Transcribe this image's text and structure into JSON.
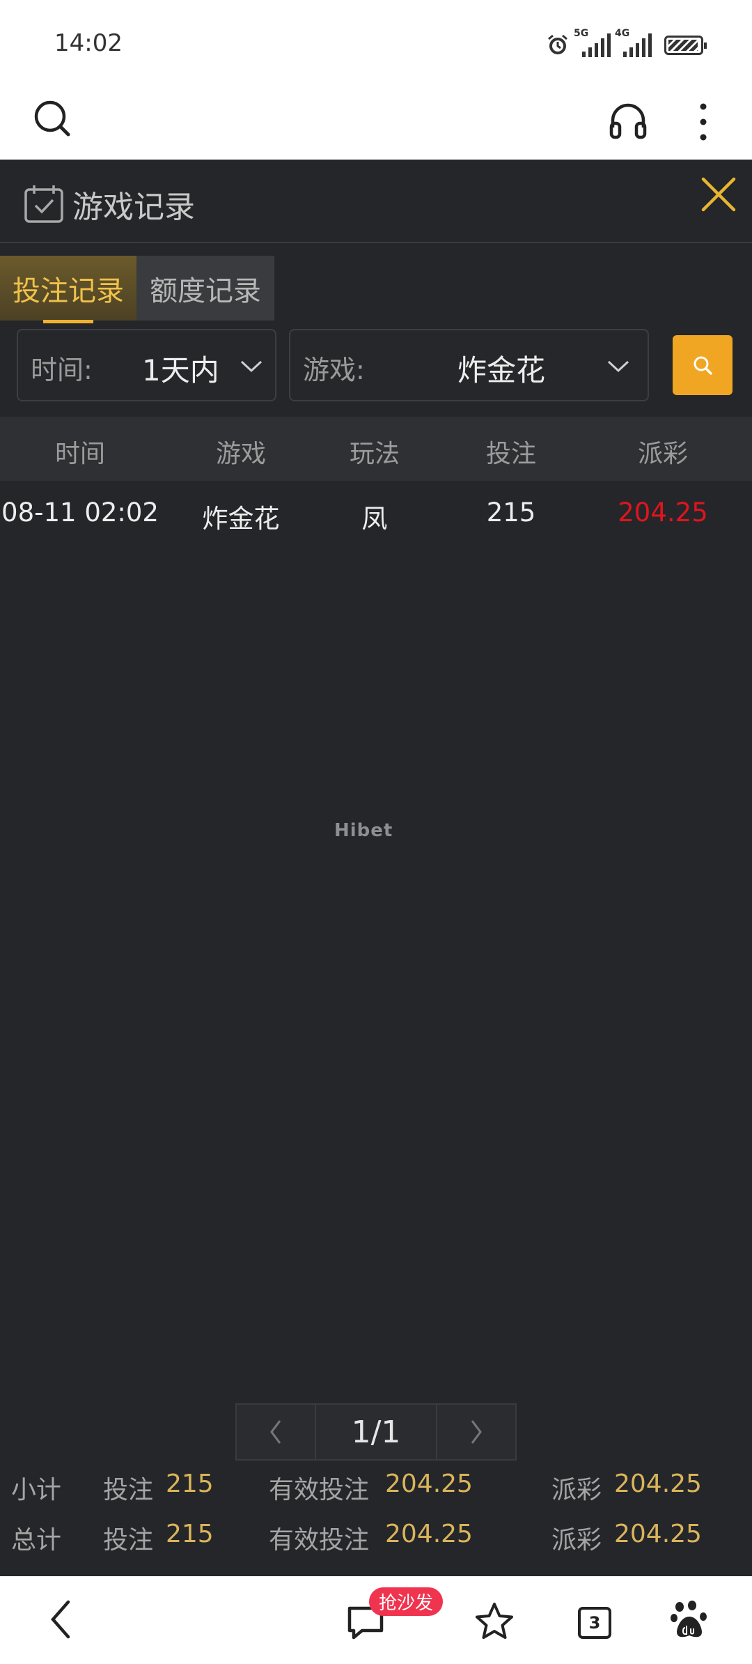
{
  "status_bar": {
    "time": "14:02",
    "signal1_label": "5G",
    "signal2_label": "4G"
  },
  "browser": {
    "icons": [
      "search-icon",
      "headset-icon",
      "more-vertical-icon"
    ]
  },
  "panel": {
    "title": "游戏记录",
    "tabs": [
      {
        "label": "投注记录",
        "active": true
      },
      {
        "label": "额度记录",
        "active": false
      }
    ],
    "filters": {
      "time_label": "时间:",
      "time_value": "1天内",
      "game_label": "游戏:",
      "game_value": "炸金花"
    },
    "table": {
      "headers": [
        "时间",
        "游戏",
        "玩法",
        "投注",
        "派彩"
      ],
      "rows": [
        {
          "time": "08-11 02:02",
          "game": "炸金花",
          "play": "凤",
          "bet": "215",
          "payout": "204.25"
        }
      ]
    },
    "watermark": "Hibet",
    "pager": {
      "current": "1/1"
    },
    "subtotal": {
      "label": "小计",
      "bet_label": "投注",
      "bet": "215",
      "valid_label": "有效投注",
      "valid": "204.25",
      "payout_label": "派彩",
      "payout": "204.25"
    },
    "total": {
      "label": "总计",
      "bet_label": "投注",
      "bet": "215",
      "valid_label": "有效投注",
      "valid": "204.25",
      "payout_label": "派彩",
      "payout": "204.25"
    }
  },
  "bottom_nav": {
    "badge": "抢沙发",
    "tab_count": "3"
  },
  "colors": {
    "panel_bg": "#25262a",
    "accent_gold": "#f0a623",
    "payout_red": "#e0141e",
    "value_gold": "#d9b45a"
  }
}
